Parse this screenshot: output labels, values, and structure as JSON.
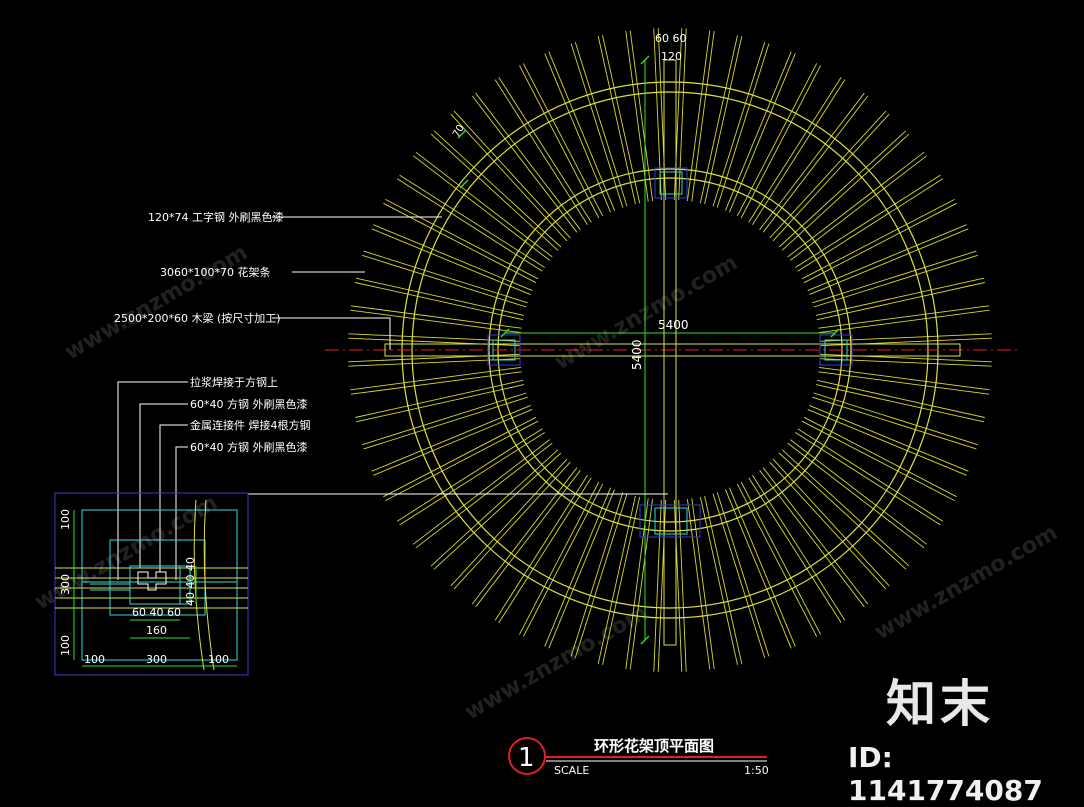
{
  "drawing": {
    "title": "环形花架顶平面图",
    "number": "1",
    "scale_label": "SCALE",
    "scale_value": "1:50",
    "rafter_count": 72
  },
  "dimensions": {
    "top_6060": "60 60",
    "top_120": "120",
    "span_h": "5400",
    "span_v": "5400",
    "rafter_gap": "70",
    "detail_100_left_top": "100",
    "detail_300_left": "300",
    "detail_100_left_bottom": "100",
    "detail_100_bottom_left": "100",
    "detail_300_bottom": "300",
    "detail_100_bottom_right": "100",
    "detail_604060": "60 40 60",
    "detail_160": "160",
    "detail_40": "40 40 40"
  },
  "labels": {
    "beam_i": "120*74  工字钢  外刷黑色漆",
    "rafter": "3060*100*70  花架条",
    "timber": "2500*200*60  木梁 (按尺寸加工)",
    "detail_1": "拉浆焊接于方钢上",
    "detail_2": "60*40  方钢  外刷黑色漆",
    "detail_3": "金属连接件  焊接4根方钢",
    "detail_4": "60*40  方钢  外刷黑色漆"
  },
  "colors": {
    "rafter": "#d8d830",
    "ring": "#e0e040",
    "dim": "#2fe02f",
    "leader": "#ffffff",
    "axis": "#e02020",
    "cyan": "#30d8d8",
    "blue": "#3a3ad8",
    "circle_mark": "#e02020"
  },
  "watermark": {
    "text": "www.znzmo.com",
    "brand": "知末",
    "id": "ID: 1141774087"
  }
}
